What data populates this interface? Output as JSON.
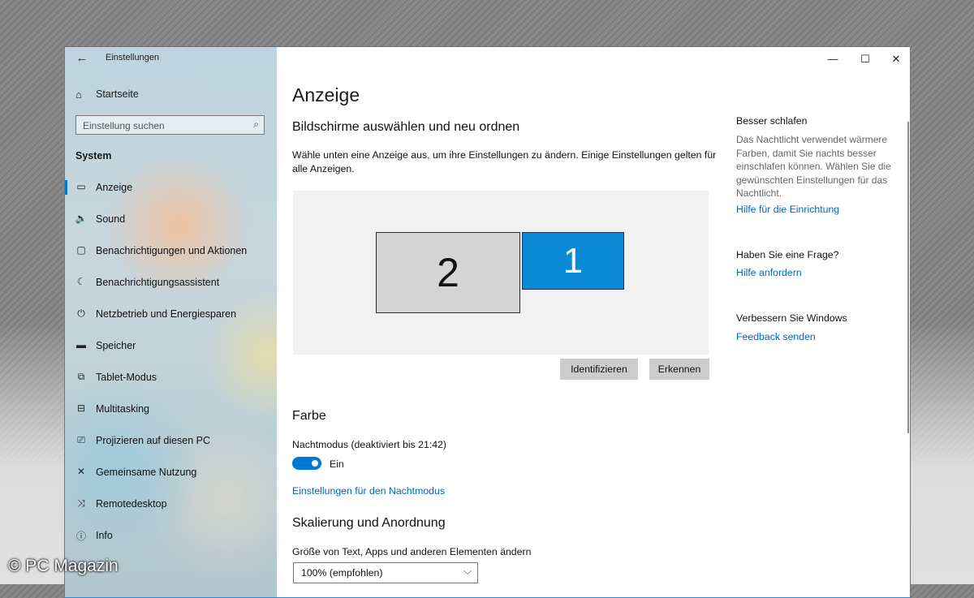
{
  "window": {
    "app_title": "Einstellungen",
    "back_icon": "←",
    "minimize_icon": "—",
    "maximize_icon": "☐",
    "close_icon": "✕"
  },
  "sidebar": {
    "home_icon": "⌂",
    "home_label": "Startseite",
    "search_placeholder": "Einstellung suchen",
    "search_icon": "⌕",
    "section_heading": "System",
    "items": [
      {
        "icon": "▭",
        "label": "Anzeige",
        "active": true
      },
      {
        "icon": "🔈",
        "label": "Sound"
      },
      {
        "icon": "▢",
        "label": "Benachrichtigungen und Aktionen"
      },
      {
        "icon": "☾",
        "label": "Benachrichtigungsassistent"
      },
      {
        "icon": "⏻",
        "label": "Netzbetrieb und Energiesparen"
      },
      {
        "icon": "▬",
        "label": "Speicher"
      },
      {
        "icon": "⧉",
        "label": "Tablet-Modus"
      },
      {
        "icon": "⊟",
        "label": "Multitasking"
      },
      {
        "icon": "⎚",
        "label": "Projizieren auf diesen PC"
      },
      {
        "icon": "✕",
        "label": "Gemeinsame Nutzung"
      },
      {
        "icon": "⤨",
        "label": "Remotedesktop"
      },
      {
        "icon": "ⓘ",
        "label": "Info"
      }
    ]
  },
  "main": {
    "page_title": "Anzeige",
    "displays": {
      "heading": "Bildschirme auswählen und neu ordnen",
      "description_line1": "Wähle unten eine Anzeige aus, um ihre Einstellungen zu ändern. Einige Einstellungen gelten für",
      "description_line2": "alle Anzeigen.",
      "monitor_2": "2",
      "monitor_1": "1",
      "identify_button": "Identifizieren",
      "detect_button": "Erkennen"
    },
    "color": {
      "heading": "Farbe",
      "night_mode_label": "Nachtmodus (deaktiviert bis 21:42)",
      "toggle_state": "Ein",
      "night_mode_settings_link": "Einstellungen für den Nachtmodus"
    },
    "scaling": {
      "heading": "Skalierung und Anordnung",
      "size_label": "Größe von Text, Apps und anderen Elementen ändern",
      "size_value": "100% (empfohlen)",
      "chevron_icon": "⌵"
    }
  },
  "right_panel": {
    "sleep_heading": "Besser schlafen",
    "sleep_text": "Das Nachtlicht verwendet wärmere Farben, damit Sie nachts besser einschlafen können. Wählen Sie die gewünschten Einstellungen für das Nachtlicht.",
    "sleep_link": "Hilfe für die Einrichtung",
    "question_heading": "Haben Sie eine Frage?",
    "question_link": "Hilfe anfordern",
    "improve_heading": "Verbessern Sie Windows",
    "improve_link": "Feedback senden"
  },
  "watermark": "© PC Magazin",
  "colors": {
    "accent": "#0078d7",
    "link": "#0067b8",
    "monitor_1": "#0a8ad6"
  }
}
